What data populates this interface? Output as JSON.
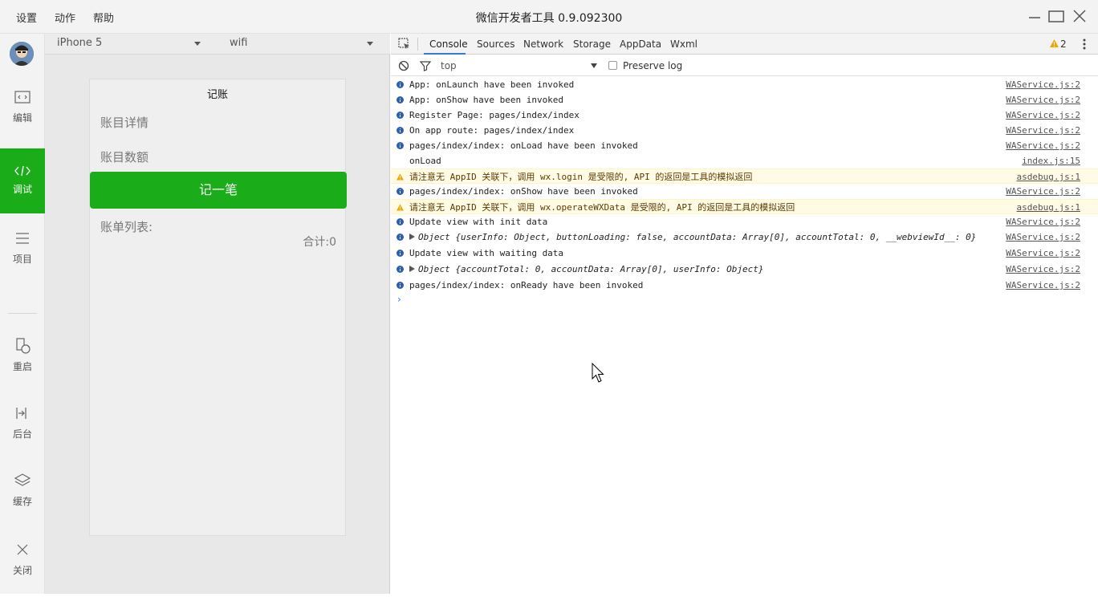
{
  "titlebar": {
    "menu": [
      "设置",
      "动作",
      "帮助"
    ],
    "title": "微信开发者工具 0.9.092300"
  },
  "sidebar": {
    "items": [
      {
        "label": "编辑",
        "icon": "code-edit-icon"
      },
      {
        "label": "调试",
        "icon": "debug-icon",
        "active": true
      },
      {
        "label": "项目",
        "icon": "list-icon"
      },
      {
        "label": "重启",
        "icon": "restart-icon"
      },
      {
        "label": "后台",
        "icon": "background-icon"
      },
      {
        "label": "缓存",
        "icon": "layers-icon"
      },
      {
        "label": "关闭",
        "icon": "close-icon"
      }
    ]
  },
  "simulator": {
    "device": "iPhone 5",
    "network": "wifi",
    "page": {
      "nav_title": "记账",
      "detail_placeholder": "账目详情",
      "amount_placeholder": "账目数额",
      "submit_label": "记一笔",
      "list_label": "账单列表:",
      "total_label": "合计:0"
    }
  },
  "devtools": {
    "tabs": [
      "Console",
      "Sources",
      "Network",
      "Storage",
      "AppData",
      "Wxml"
    ],
    "active_tab": "Console",
    "warning_count": "2",
    "context": "top",
    "preserve_log_label": "Preserve log",
    "logs": [
      {
        "type": "info",
        "text": "App: onLaunch have been invoked",
        "source": "WAService.js:2"
      },
      {
        "type": "info",
        "text": "App: onShow have been invoked",
        "source": "WAService.js:2"
      },
      {
        "type": "info",
        "text": "Register Page: pages/index/index",
        "source": "WAService.js:2"
      },
      {
        "type": "info",
        "text": "On app route: pages/index/index",
        "source": "WAService.js:2"
      },
      {
        "type": "info",
        "text": "pages/index/index: onLoad have been invoked",
        "source": "WAService.js:2"
      },
      {
        "type": "log",
        "text": "onLoad",
        "source": "index.js:15"
      },
      {
        "type": "warn",
        "text": "请注意无 AppID 关联下，调用 wx.login 是受限的, API 的返回是工具的模拟返回",
        "source": "asdebug.js:1"
      },
      {
        "type": "info",
        "text": "pages/index/index: onShow have been invoked",
        "source": "WAService.js:2"
      },
      {
        "type": "warn",
        "text": "请注意无 AppID 关联下，调用 wx.operateWXData 是受限的, API 的返回是工具的模拟返回",
        "source": "asdebug.js:1"
      },
      {
        "type": "info",
        "text": "Update view with init data",
        "source": "WAService.js:2"
      },
      {
        "type": "object",
        "text": "Object {userInfo: Object, buttonLoading: false, accountData: Array[0], accountTotal: 0, __webviewId__: 0}",
        "source": "WAService.js:2"
      },
      {
        "type": "info",
        "text": "Update view with waiting data",
        "source": "WAService.js:2"
      },
      {
        "type": "object",
        "text": "Object {accountTotal: 0, accountData: Array[0], userInfo: Object}",
        "source": "WAService.js:2"
      },
      {
        "type": "info",
        "text": "pages/index/index: onReady have been invoked",
        "source": "WAService.js:2"
      }
    ],
    "prompt": "›"
  },
  "colors": {
    "accent": "#1aad19",
    "warn_bg": "#fffbe5",
    "link": "#545454"
  }
}
